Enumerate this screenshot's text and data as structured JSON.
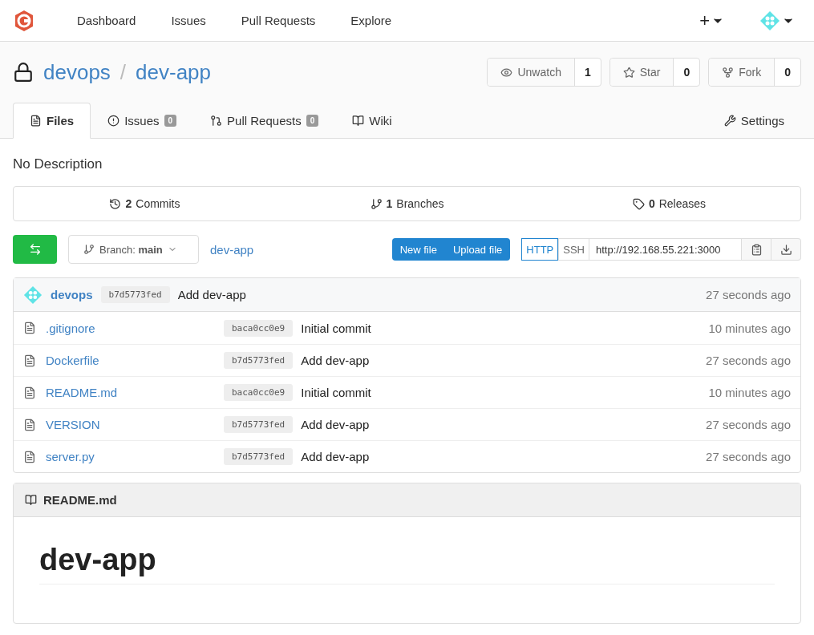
{
  "nav": {
    "items": [
      {
        "label": "Dashboard"
      },
      {
        "label": "Issues"
      },
      {
        "label": "Pull Requests"
      },
      {
        "label": "Explore"
      }
    ],
    "plus": "+"
  },
  "repo": {
    "owner": "devops",
    "separator": "/",
    "name": "dev-app",
    "private": true,
    "actions": [
      {
        "kind": "watch",
        "label": "Unwatch",
        "count": "1"
      },
      {
        "kind": "star",
        "label": "Star",
        "count": "0"
      },
      {
        "kind": "fork",
        "label": "Fork",
        "count": "0"
      }
    ]
  },
  "tabs": [
    {
      "kind": "files",
      "label": "Files",
      "selected": true
    },
    {
      "kind": "issues",
      "label": "Issues",
      "count": "0",
      "selected": false
    },
    {
      "kind": "pulls",
      "label": "Pull Requests",
      "count": "0",
      "selected": false
    },
    {
      "kind": "wiki",
      "label": "Wiki",
      "selected": false
    },
    {
      "kind": "settings",
      "label": "Settings",
      "selected": false
    }
  ],
  "description": "No Description",
  "stats": [
    {
      "kind": "commits",
      "count": "2",
      "label": "Commits"
    },
    {
      "kind": "branches",
      "count": "1",
      "label": "Branches"
    },
    {
      "kind": "releases",
      "count": "0",
      "label": "Releases"
    }
  ],
  "toolbar": {
    "branch_label": "Branch:",
    "branch": "main",
    "path": "dev-app",
    "buttons": [
      "New file",
      "Upload file"
    ],
    "protocols": [
      {
        "label": "HTTP",
        "selected": true
      },
      {
        "label": "SSH",
        "selected": false
      }
    ],
    "clone_url": "http://192.168.55.221:3000"
  },
  "latest_commit": {
    "author": "devops",
    "sha": "b7d5773fed",
    "message": "Add dev-app",
    "time": "27 seconds ago"
  },
  "files": [
    {
      "name": ".gitignore",
      "sha": "baca0cc0e9",
      "message": "Initial commit",
      "time": "10 minutes ago"
    },
    {
      "name": "Dockerfile",
      "sha": "b7d5773fed",
      "message": "Add dev-app",
      "time": "27 seconds ago"
    },
    {
      "name": "README.md",
      "sha": "baca0cc0e9",
      "message": "Initial commit",
      "time": "10 minutes ago"
    },
    {
      "name": "VERSION",
      "sha": "b7d5773fed",
      "message": "Add dev-app",
      "time": "27 seconds ago"
    },
    {
      "name": "server.py",
      "sha": "b7d5773fed",
      "message": "Add dev-app",
      "time": "27 seconds ago"
    }
  ],
  "readme": {
    "filename": "README.md",
    "heading": "dev-app"
  }
}
